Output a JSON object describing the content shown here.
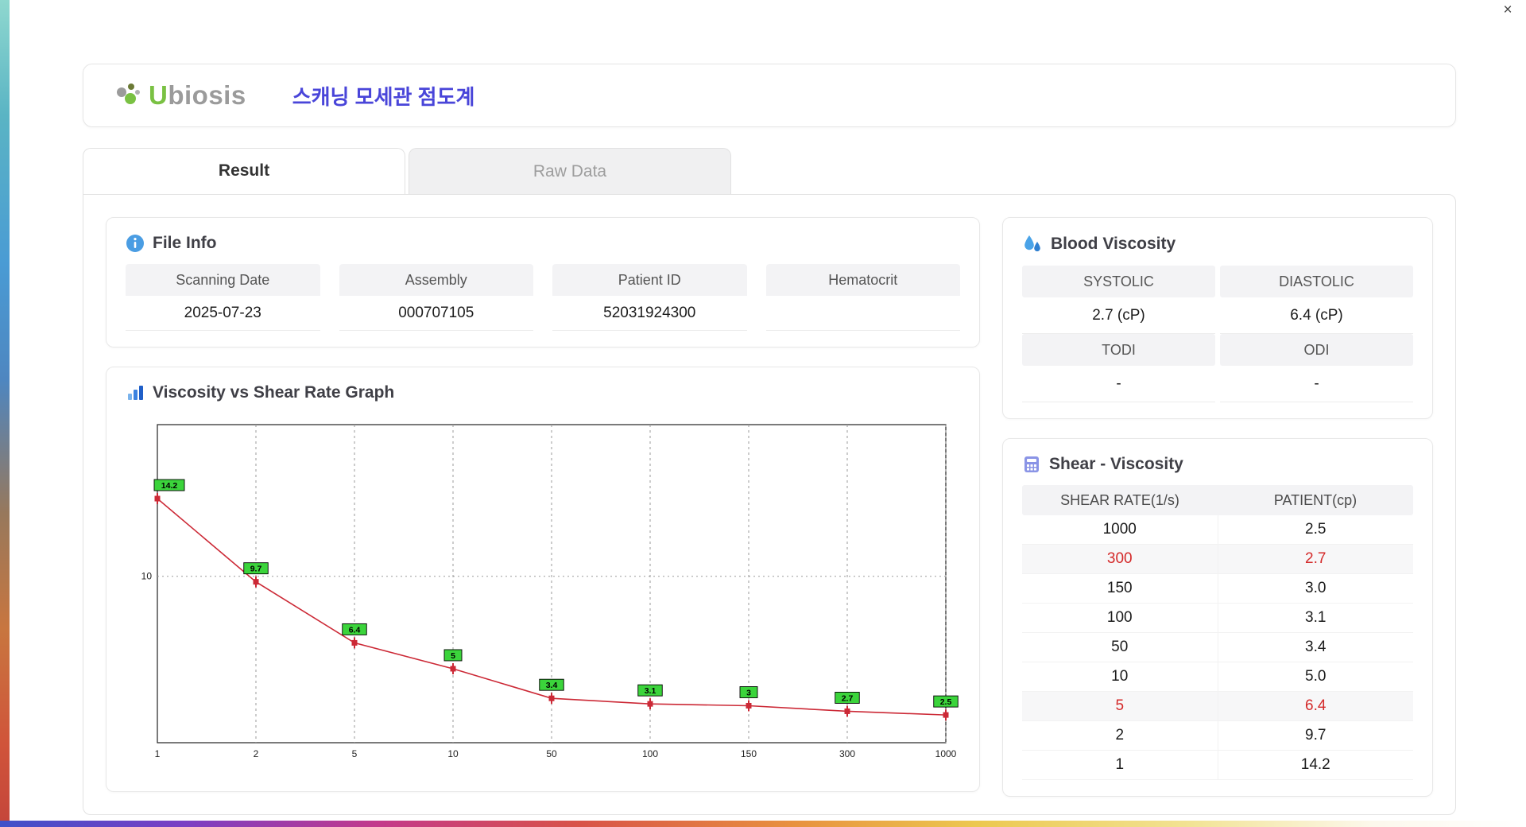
{
  "window": {
    "close_label": "×"
  },
  "header": {
    "logo_u": "U",
    "logo_rest": "biosis",
    "title": "스캐닝 모세관 점도계"
  },
  "tabs": {
    "result": "Result",
    "raw_data": "Raw Data"
  },
  "file_info": {
    "section_title": "File Info",
    "fields": [
      {
        "label": "Scanning Date",
        "value": "2025-07-23"
      },
      {
        "label": "Assembly",
        "value": "000707105"
      },
      {
        "label": "Patient ID",
        "value": "52031924300"
      },
      {
        "label": "Hematocrit",
        "value": ""
      }
    ]
  },
  "blood_viscosity": {
    "section_title": "Blood Viscosity",
    "systolic_label": "SYSTOLIC",
    "systolic_value": "2.7 (cP)",
    "diastolic_label": "DIASTOLIC",
    "diastolic_value": "6.4 (cP)",
    "todi_label": "TODI",
    "todi_value": "-",
    "odi_label": "ODI",
    "odi_value": "-"
  },
  "graph_section": {
    "section_title": "Viscosity vs Shear Rate Graph"
  },
  "chart_data": {
    "type": "line",
    "title": "Viscosity vs Shear Rate Graph",
    "x_categories": [
      "1",
      "2",
      "5",
      "10",
      "50",
      "100",
      "150",
      "300",
      "1000"
    ],
    "values": [
      14.2,
      9.7,
      6.4,
      5,
      3.4,
      3.1,
      3,
      2.7,
      2.5
    ],
    "point_labels": [
      "14.2",
      "9.7",
      "6.4",
      "5",
      "3.4",
      "3.1",
      "3",
      "2.7",
      "2.5"
    ],
    "y_ticks": [
      10
    ],
    "y_range": [
      1,
      18.2
    ],
    "x_axis_note": "categorical ticks at shear rates (1/s), evenly spaced",
    "xlabel": "",
    "ylabel": "",
    "grid": true,
    "line_color": "#cc2936",
    "marker_color": "#cc2936",
    "label_bg_color": "#3bd43b",
    "label_text_color": "#000000"
  },
  "shear_table": {
    "section_title": "Shear - Viscosity",
    "headers": [
      "SHEAR RATE(1/s)",
      "PATIENT(cp)"
    ],
    "rows": [
      {
        "shear": "1000",
        "patient": "2.5",
        "highlight": false
      },
      {
        "shear": "300",
        "patient": "2.7",
        "highlight": true
      },
      {
        "shear": "150",
        "patient": "3.0",
        "highlight": false
      },
      {
        "shear": "100",
        "patient": "3.1",
        "highlight": false
      },
      {
        "shear": "50",
        "patient": "3.4",
        "highlight": false
      },
      {
        "shear": "10",
        "patient": "5.0",
        "highlight": false
      },
      {
        "shear": "5",
        "patient": "6.4",
        "highlight": true
      },
      {
        "shear": "2",
        "patient": "9.7",
        "highlight": false
      },
      {
        "shear": "1",
        "patient": "14.2",
        "highlight": false
      }
    ]
  }
}
